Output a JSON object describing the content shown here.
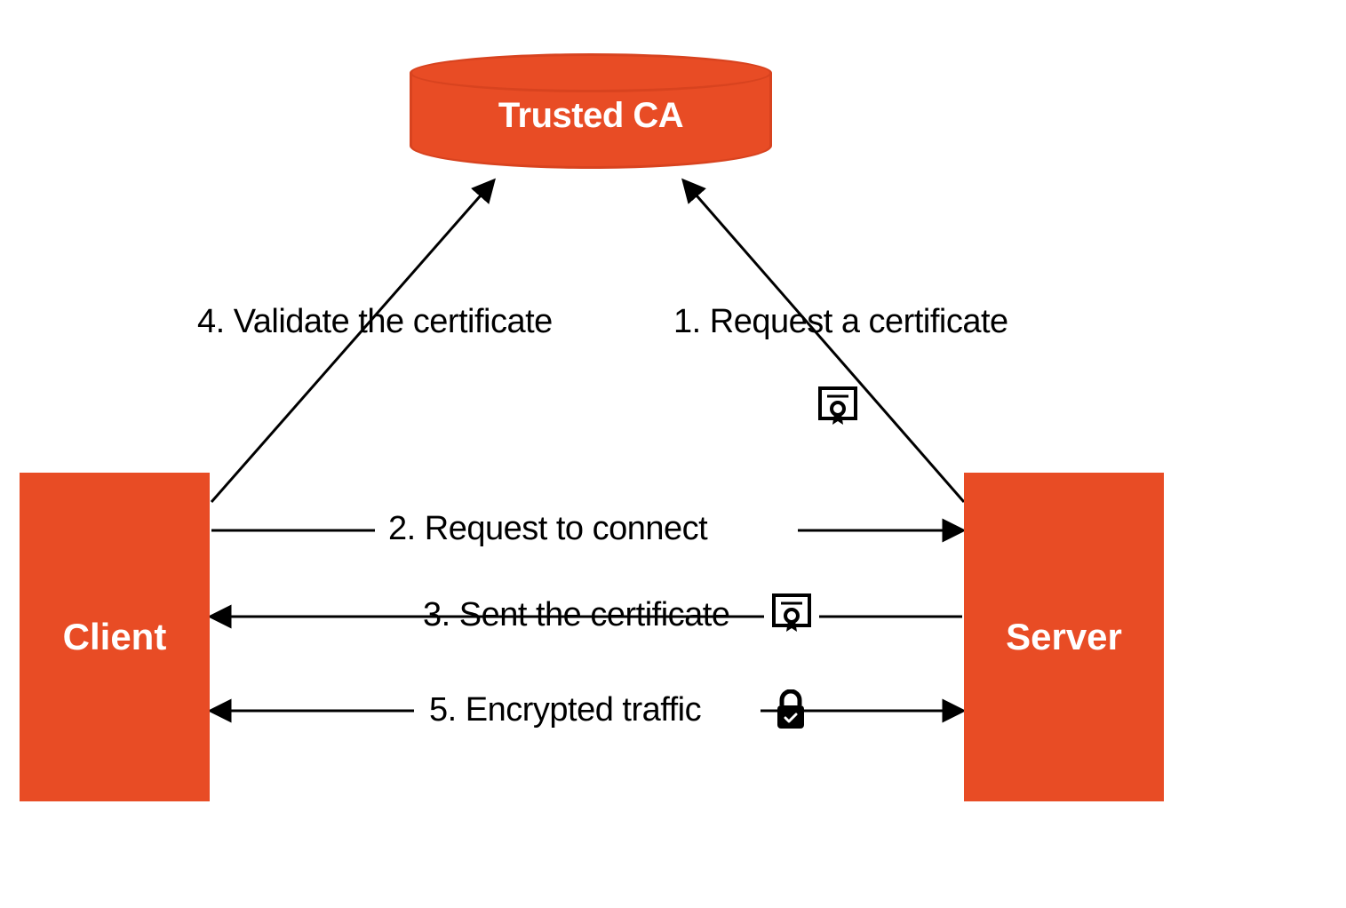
{
  "nodes": {
    "ca": "Trusted CA",
    "client": "Client",
    "server": "Server"
  },
  "steps": {
    "s1": "1. Request a certificate",
    "s2": "2. Request to connect",
    "s3": "3. Sent the certificate",
    "s4": "4. Validate the certificate",
    "s5": "5. Encrypted traffic"
  },
  "icons": {
    "cert1": "certificate-icon",
    "cert3": "certificate-icon",
    "lock5": "lock-icon"
  },
  "colors": {
    "primary": "#E84C25",
    "primary_border": "#D8431F",
    "text_on_primary": "#FFFFFF",
    "line": "#000000"
  }
}
